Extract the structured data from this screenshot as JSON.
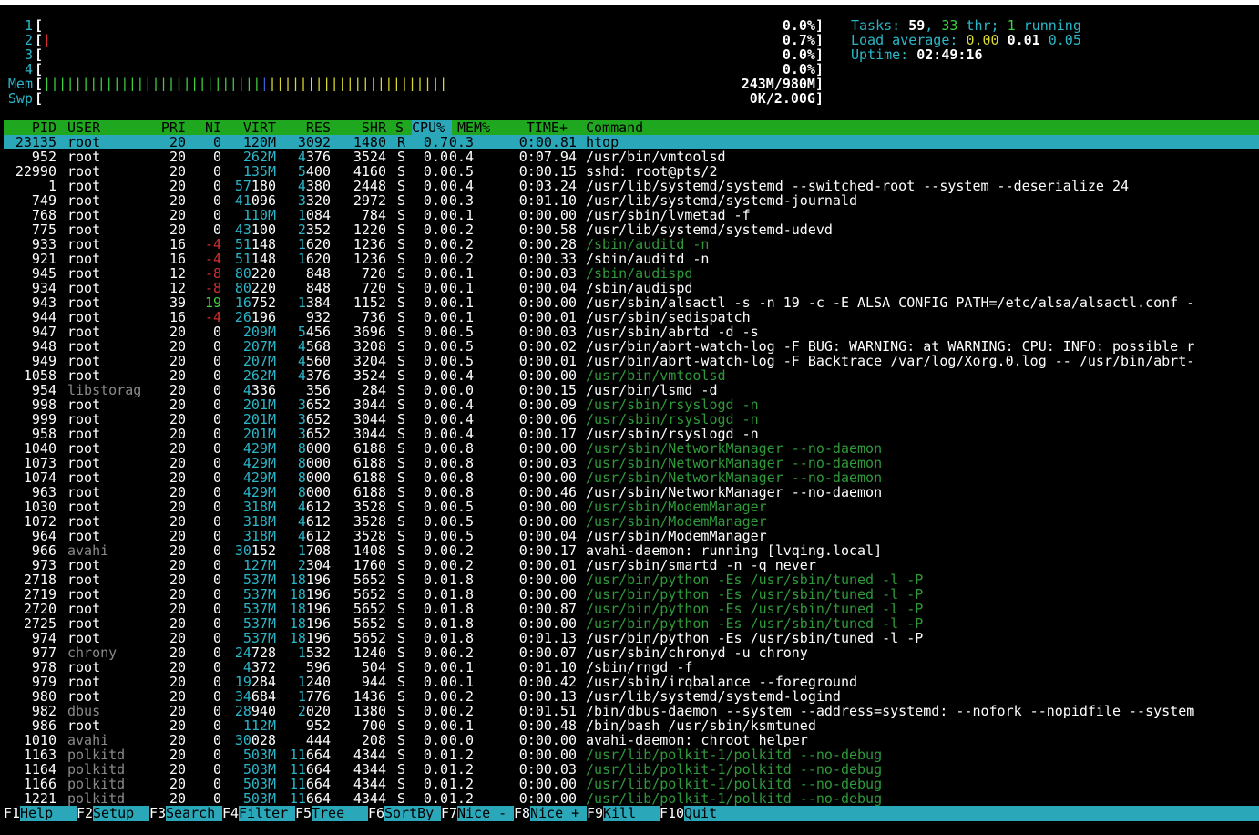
{
  "meters": {
    "cpus": [
      {
        "label": "1",
        "bar": "",
        "pct": "0.0%]"
      },
      {
        "label": "2",
        "bar": "|",
        "pct": "0.7%]"
      },
      {
        "label": "3",
        "bar": "",
        "pct": "0.0%]"
      },
      {
        "label": "4",
        "bar": "",
        "pct": "0.0%]"
      }
    ],
    "mem": {
      "label": "Mem",
      "bar_green": "||||||||||||||||||||||||||||",
      "bar_blue": "|",
      "bar_yellow": "|||||||||||||||||||||||",
      "value": "243M/980M]"
    },
    "swp": {
      "label": "Swp",
      "bar": "",
      "value": "0K/2.00G]"
    },
    "open_bracket": "["
  },
  "summary": {
    "tasks_label": "Tasks: ",
    "tasks": "59",
    "sep": ", ",
    "threads": "33",
    "thr_label": " thr; ",
    "running": "1",
    "running_label": " running",
    "load_label": "Load average: ",
    "load1": "0.00",
    "load5": "0.01",
    "load15": "0.05",
    "uptime_label": "Uptime: ",
    "uptime": "02:49:16"
  },
  "columns": {
    "pid": "PID",
    "user": "USER",
    "pri": "PRI",
    "ni": "NI",
    "virt": "VIRT",
    "res": "RES",
    "shr": "SHR",
    "s": "S",
    "cpu": "CPU%",
    "mem": "MEM%",
    "time": "TIME+",
    "cmd": "Command"
  },
  "processes": [
    {
      "pid": "23135",
      "user": "root",
      "pri": "20",
      "ni": "0",
      "virt": "120M",
      "res": "3092",
      "shr": "1480",
      "s": "R",
      "cpu": "0.7",
      "mem": "0.3",
      "time": "0:00.81",
      "cmd": "htop",
      "thread": false
    },
    {
      "pid": "952",
      "user": "root",
      "pri": "20",
      "ni": "0",
      "virt": "262M",
      "res": "4376",
      "shr": "3524",
      "s": "S",
      "cpu": "0.0",
      "mem": "0.4",
      "time": "0:07.94",
      "cmd": "/usr/bin/vmtoolsd",
      "thread": false
    },
    {
      "pid": "22990",
      "user": "root",
      "pri": "20",
      "ni": "0",
      "virt": "135M",
      "res": "5400",
      "shr": "4160",
      "s": "S",
      "cpu": "0.0",
      "mem": "0.5",
      "time": "0:00.15",
      "cmd": "sshd: root@pts/2",
      "thread": false
    },
    {
      "pid": "1",
      "user": "root",
      "pri": "20",
      "ni": "0",
      "virt": "57180",
      "res": "4380",
      "shr": "2448",
      "s": "S",
      "cpu": "0.0",
      "mem": "0.4",
      "time": "0:03.24",
      "cmd": "/usr/lib/systemd/systemd --switched-root --system --deserialize 24",
      "thread": false
    },
    {
      "pid": "749",
      "user": "root",
      "pri": "20",
      "ni": "0",
      "virt": "41096",
      "res": "3320",
      "shr": "2972",
      "s": "S",
      "cpu": "0.0",
      "mem": "0.3",
      "time": "0:01.10",
      "cmd": "/usr/lib/systemd/systemd-journald",
      "thread": false
    },
    {
      "pid": "768",
      "user": "root",
      "pri": "20",
      "ni": "0",
      "virt": "110M",
      "res": "1084",
      "shr": "784",
      "s": "S",
      "cpu": "0.0",
      "mem": "0.1",
      "time": "0:00.00",
      "cmd": "/usr/sbin/lvmetad -f",
      "thread": false
    },
    {
      "pid": "775",
      "user": "root",
      "pri": "20",
      "ni": "0",
      "virt": "43100",
      "res": "2352",
      "shr": "1220",
      "s": "S",
      "cpu": "0.0",
      "mem": "0.2",
      "time": "0:00.58",
      "cmd": "/usr/lib/systemd/systemd-udevd",
      "thread": false
    },
    {
      "pid": "933",
      "user": "root",
      "pri": "16",
      "ni": "-4",
      "virt": "51148",
      "res": "1620",
      "shr": "1236",
      "s": "S",
      "cpu": "0.0",
      "mem": "0.2",
      "time": "0:00.28",
      "cmd": "/sbin/auditd -n",
      "thread": true
    },
    {
      "pid": "921",
      "user": "root",
      "pri": "16",
      "ni": "-4",
      "virt": "51148",
      "res": "1620",
      "shr": "1236",
      "s": "S",
      "cpu": "0.0",
      "mem": "0.2",
      "time": "0:00.33",
      "cmd": "/sbin/auditd -n",
      "thread": false
    },
    {
      "pid": "945",
      "user": "root",
      "pri": "12",
      "ni": "-8",
      "virt": "80220",
      "res": "848",
      "shr": "720",
      "s": "S",
      "cpu": "0.0",
      "mem": "0.1",
      "time": "0:00.03",
      "cmd": "/sbin/audispd",
      "thread": true
    },
    {
      "pid": "934",
      "user": "root",
      "pri": "12",
      "ni": "-8",
      "virt": "80220",
      "res": "848",
      "shr": "720",
      "s": "S",
      "cpu": "0.0",
      "mem": "0.1",
      "time": "0:00.04",
      "cmd": "/sbin/audispd",
      "thread": false
    },
    {
      "pid": "943",
      "user": "root",
      "pri": "39",
      "ni": "19",
      "virt": "16752",
      "res": "1384",
      "shr": "1152",
      "s": "S",
      "cpu": "0.0",
      "mem": "0.1",
      "time": "0:00.00",
      "cmd": "/usr/sbin/alsactl -s -n 19 -c -E ALSA_CONFIG_PATH=/etc/alsa/alsactl.conf -",
      "thread": false
    },
    {
      "pid": "944",
      "user": "root",
      "pri": "16",
      "ni": "-4",
      "virt": "26196",
      "res": "932",
      "shr": "736",
      "s": "S",
      "cpu": "0.0",
      "mem": "0.1",
      "time": "0:00.01",
      "cmd": "/usr/sbin/sedispatch",
      "thread": false
    },
    {
      "pid": "947",
      "user": "root",
      "pri": "20",
      "ni": "0",
      "virt": "209M",
      "res": "5456",
      "shr": "3696",
      "s": "S",
      "cpu": "0.0",
      "mem": "0.5",
      "time": "0:00.03",
      "cmd": "/usr/sbin/abrtd -d -s",
      "thread": false
    },
    {
      "pid": "948",
      "user": "root",
      "pri": "20",
      "ni": "0",
      "virt": "207M",
      "res": "4568",
      "shr": "3208",
      "s": "S",
      "cpu": "0.0",
      "mem": "0.5",
      "time": "0:00.02",
      "cmd": "/usr/bin/abrt-watch-log -F BUG: WARNING: at WARNING: CPU: INFO: possible r",
      "thread": false
    },
    {
      "pid": "949",
      "user": "root",
      "pri": "20",
      "ni": "0",
      "virt": "207M",
      "res": "4560",
      "shr": "3204",
      "s": "S",
      "cpu": "0.0",
      "mem": "0.5",
      "time": "0:00.01",
      "cmd": "/usr/bin/abrt-watch-log -F Backtrace /var/log/Xorg.0.log -- /usr/bin/abrt-",
      "thread": false
    },
    {
      "pid": "1058",
      "user": "root",
      "pri": "20",
      "ni": "0",
      "virt": "262M",
      "res": "4376",
      "shr": "3524",
      "s": "S",
      "cpu": "0.0",
      "mem": "0.4",
      "time": "0:00.00",
      "cmd": "/usr/bin/vmtoolsd",
      "thread": true
    },
    {
      "pid": "954",
      "user": "libstorag",
      "pri": "20",
      "ni": "0",
      "virt": "4336",
      "res": "356",
      "shr": "284",
      "s": "S",
      "cpu": "0.0",
      "mem": "0.0",
      "time": "0:00.15",
      "cmd": "/usr/bin/lsmd -d",
      "thread": false
    },
    {
      "pid": "998",
      "user": "root",
      "pri": "20",
      "ni": "0",
      "virt": "201M",
      "res": "3652",
      "shr": "3044",
      "s": "S",
      "cpu": "0.0",
      "mem": "0.4",
      "time": "0:00.09",
      "cmd": "/usr/sbin/rsyslogd -n",
      "thread": true
    },
    {
      "pid": "999",
      "user": "root",
      "pri": "20",
      "ni": "0",
      "virt": "201M",
      "res": "3652",
      "shr": "3044",
      "s": "S",
      "cpu": "0.0",
      "mem": "0.4",
      "time": "0:00.06",
      "cmd": "/usr/sbin/rsyslogd -n",
      "thread": true
    },
    {
      "pid": "958",
      "user": "root",
      "pri": "20",
      "ni": "0",
      "virt": "201M",
      "res": "3652",
      "shr": "3044",
      "s": "S",
      "cpu": "0.0",
      "mem": "0.4",
      "time": "0:00.17",
      "cmd": "/usr/sbin/rsyslogd -n",
      "thread": false
    },
    {
      "pid": "1040",
      "user": "root",
      "pri": "20",
      "ni": "0",
      "virt": "429M",
      "res": "8000",
      "shr": "6188",
      "s": "S",
      "cpu": "0.0",
      "mem": "0.8",
      "time": "0:00.00",
      "cmd": "/usr/sbin/NetworkManager --no-daemon",
      "thread": true
    },
    {
      "pid": "1073",
      "user": "root",
      "pri": "20",
      "ni": "0",
      "virt": "429M",
      "res": "8000",
      "shr": "6188",
      "s": "S",
      "cpu": "0.0",
      "mem": "0.8",
      "time": "0:00.03",
      "cmd": "/usr/sbin/NetworkManager --no-daemon",
      "thread": true
    },
    {
      "pid": "1074",
      "user": "root",
      "pri": "20",
      "ni": "0",
      "virt": "429M",
      "res": "8000",
      "shr": "6188",
      "s": "S",
      "cpu": "0.0",
      "mem": "0.8",
      "time": "0:00.00",
      "cmd": "/usr/sbin/NetworkManager --no-daemon",
      "thread": true
    },
    {
      "pid": "963",
      "user": "root",
      "pri": "20",
      "ni": "0",
      "virt": "429M",
      "res": "8000",
      "shr": "6188",
      "s": "S",
      "cpu": "0.0",
      "mem": "0.8",
      "time": "0:00.46",
      "cmd": "/usr/sbin/NetworkManager --no-daemon",
      "thread": false
    },
    {
      "pid": "1030",
      "user": "root",
      "pri": "20",
      "ni": "0",
      "virt": "318M",
      "res": "4612",
      "shr": "3528",
      "s": "S",
      "cpu": "0.0",
      "mem": "0.5",
      "time": "0:00.00",
      "cmd": "/usr/sbin/ModemManager",
      "thread": true
    },
    {
      "pid": "1072",
      "user": "root",
      "pri": "20",
      "ni": "0",
      "virt": "318M",
      "res": "4612",
      "shr": "3528",
      "s": "S",
      "cpu": "0.0",
      "mem": "0.5",
      "time": "0:00.00",
      "cmd": "/usr/sbin/ModemManager",
      "thread": true
    },
    {
      "pid": "964",
      "user": "root",
      "pri": "20",
      "ni": "0",
      "virt": "318M",
      "res": "4612",
      "shr": "3528",
      "s": "S",
      "cpu": "0.0",
      "mem": "0.5",
      "time": "0:00.04",
      "cmd": "/usr/sbin/ModemManager",
      "thread": false
    },
    {
      "pid": "966",
      "user": "avahi",
      "pri": "20",
      "ni": "0",
      "virt": "30152",
      "res": "1708",
      "shr": "1408",
      "s": "S",
      "cpu": "0.0",
      "mem": "0.2",
      "time": "0:00.17",
      "cmd": "avahi-daemon: running [lvqing.local]",
      "thread": false
    },
    {
      "pid": "973",
      "user": "root",
      "pri": "20",
      "ni": "0",
      "virt": "127M",
      "res": "2304",
      "shr": "1760",
      "s": "S",
      "cpu": "0.0",
      "mem": "0.2",
      "time": "0:00.01",
      "cmd": "/usr/sbin/smartd -n -q never",
      "thread": false
    },
    {
      "pid": "2718",
      "user": "root",
      "pri": "20",
      "ni": "0",
      "virt": "537M",
      "res": "18196",
      "shr": "5652",
      "s": "S",
      "cpu": "0.0",
      "mem": "1.8",
      "time": "0:00.00",
      "cmd": "/usr/bin/python -Es /usr/sbin/tuned -l -P",
      "thread": true
    },
    {
      "pid": "2719",
      "user": "root",
      "pri": "20",
      "ni": "0",
      "virt": "537M",
      "res": "18196",
      "shr": "5652",
      "s": "S",
      "cpu": "0.0",
      "mem": "1.8",
      "time": "0:00.00",
      "cmd": "/usr/bin/python -Es /usr/sbin/tuned -l -P",
      "thread": true
    },
    {
      "pid": "2720",
      "user": "root",
      "pri": "20",
      "ni": "0",
      "virt": "537M",
      "res": "18196",
      "shr": "5652",
      "s": "S",
      "cpu": "0.0",
      "mem": "1.8",
      "time": "0:00.87",
      "cmd": "/usr/bin/python -Es /usr/sbin/tuned -l -P",
      "thread": true
    },
    {
      "pid": "2725",
      "user": "root",
      "pri": "20",
      "ni": "0",
      "virt": "537M",
      "res": "18196",
      "shr": "5652",
      "s": "S",
      "cpu": "0.0",
      "mem": "1.8",
      "time": "0:00.00",
      "cmd": "/usr/bin/python -Es /usr/sbin/tuned -l -P",
      "thread": true
    },
    {
      "pid": "974",
      "user": "root",
      "pri": "20",
      "ni": "0",
      "virt": "537M",
      "res": "18196",
      "shr": "5652",
      "s": "S",
      "cpu": "0.0",
      "mem": "1.8",
      "time": "0:01.13",
      "cmd": "/usr/bin/python -Es /usr/sbin/tuned -l -P",
      "thread": false
    },
    {
      "pid": "977",
      "user": "chrony",
      "pri": "20",
      "ni": "0",
      "virt": "24728",
      "res": "1532",
      "shr": "1240",
      "s": "S",
      "cpu": "0.0",
      "mem": "0.2",
      "time": "0:00.07",
      "cmd": "/usr/sbin/chronyd -u chrony",
      "thread": false
    },
    {
      "pid": "978",
      "user": "root",
      "pri": "20",
      "ni": "0",
      "virt": "4372",
      "res": "596",
      "shr": "504",
      "s": "S",
      "cpu": "0.0",
      "mem": "0.1",
      "time": "0:01.10",
      "cmd": "/sbin/rngd -f",
      "thread": false
    },
    {
      "pid": "979",
      "user": "root",
      "pri": "20",
      "ni": "0",
      "virt": "19284",
      "res": "1240",
      "shr": "944",
      "s": "S",
      "cpu": "0.0",
      "mem": "0.1",
      "time": "0:00.42",
      "cmd": "/usr/sbin/irqbalance --foreground",
      "thread": false
    },
    {
      "pid": "980",
      "user": "root",
      "pri": "20",
      "ni": "0",
      "virt": "34684",
      "res": "1776",
      "shr": "1436",
      "s": "S",
      "cpu": "0.0",
      "mem": "0.2",
      "time": "0:00.13",
      "cmd": "/usr/lib/systemd/systemd-logind",
      "thread": false
    },
    {
      "pid": "982",
      "user": "dbus",
      "pri": "20",
      "ni": "0",
      "virt": "28940",
      "res": "2020",
      "shr": "1380",
      "s": "S",
      "cpu": "0.0",
      "mem": "0.2",
      "time": "0:01.51",
      "cmd": "/bin/dbus-daemon --system --address=systemd: --nofork --nopidfile --system",
      "thread": false
    },
    {
      "pid": "986",
      "user": "root",
      "pri": "20",
      "ni": "0",
      "virt": "112M",
      "res": "952",
      "shr": "700",
      "s": "S",
      "cpu": "0.0",
      "mem": "0.1",
      "time": "0:00.48",
      "cmd": "/bin/bash /usr/sbin/ksmtuned",
      "thread": false
    },
    {
      "pid": "1010",
      "user": "avahi",
      "pri": "20",
      "ni": "0",
      "virt": "30028",
      "res": "444",
      "shr": "208",
      "s": "S",
      "cpu": "0.0",
      "mem": "0.0",
      "time": "0:00.00",
      "cmd": "avahi-daemon: chroot helper",
      "thread": false
    },
    {
      "pid": "1163",
      "user": "polkitd",
      "pri": "20",
      "ni": "0",
      "virt": "503M",
      "res": "11664",
      "shr": "4344",
      "s": "S",
      "cpu": "0.0",
      "mem": "1.2",
      "time": "0:00.00",
      "cmd": "/usr/lib/polkit-1/polkitd --no-debug",
      "thread": true
    },
    {
      "pid": "1164",
      "user": "polkitd",
      "pri": "20",
      "ni": "0",
      "virt": "503M",
      "res": "11664",
      "shr": "4344",
      "s": "S",
      "cpu": "0.0",
      "mem": "1.2",
      "time": "0:00.03",
      "cmd": "/usr/lib/polkit-1/polkitd --no-debug",
      "thread": true
    },
    {
      "pid": "1166",
      "user": "polkitd",
      "pri": "20",
      "ni": "0",
      "virt": "503M",
      "res": "11664",
      "shr": "4344",
      "s": "S",
      "cpu": "0.0",
      "mem": "1.2",
      "time": "0:00.00",
      "cmd": "/usr/lib/polkit-1/polkitd --no-debug",
      "thread": true
    },
    {
      "pid": "1221",
      "user": "polkitd",
      "pri": "20",
      "ni": "0",
      "virt": "503M",
      "res": "11664",
      "shr": "4344",
      "s": "S",
      "cpu": "0.0",
      "mem": "1.2",
      "time": "0:00.00",
      "cmd": "/usr/lib/polkit-1/polkitd --no-debug",
      "thread": true
    }
  ],
  "footer": [
    {
      "key": "F1",
      "label": "Help  "
    },
    {
      "key": "F2",
      "label": "Setup "
    },
    {
      "key": "F3",
      "label": "Search"
    },
    {
      "key": "F4",
      "label": "Filter"
    },
    {
      "key": "F5",
      "label": "Tree  "
    },
    {
      "key": "F6",
      "label": "SortBy"
    },
    {
      "key": "F7",
      "label": "Nice -"
    },
    {
      "key": "F8",
      "label": "Nice +"
    },
    {
      "key": "F9",
      "label": "Kill  "
    },
    {
      "key": "F10",
      "label": "Quit  "
    }
  ],
  "colors": {
    "cyan": "#2ab7c9",
    "green": "#3fcf3f",
    "header_bg": "#1fa81f",
    "selection_bg": "#2aa7b8",
    "red": "#d03030",
    "yellow": "#d8d830",
    "blue": "#3a5fd0"
  }
}
